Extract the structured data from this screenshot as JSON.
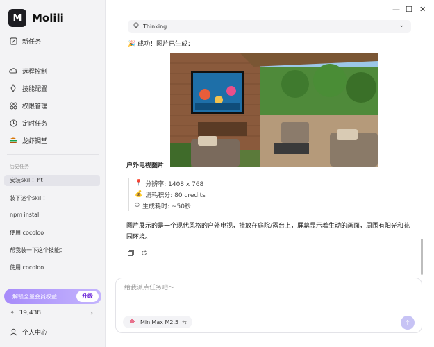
{
  "app": {
    "name": "Molili",
    "logo_text": "M"
  },
  "sidebar": {
    "new_task": "新任务",
    "items": [
      {
        "label": "远程控制",
        "icon": "cloud-icon"
      },
      {
        "label": "技能配置",
        "icon": "skill-icon"
      },
      {
        "label": "权限管理",
        "icon": "grid-icon"
      },
      {
        "label": "定时任务",
        "icon": "clock-icon"
      },
      {
        "label": "龙虾鲷堂",
        "icon": "burger-icon"
      }
    ],
    "history_label": "历史任务",
    "history": [
      "安装skill：ht",
      "装下这个skill：",
      "npm instal",
      "使用 cocoloo",
      "帮我装一下这个技能：",
      "使用 cocoloo"
    ],
    "vip_label": "解锁全量会员权益",
    "vip_button": "升级",
    "credits": "19,438",
    "profile": "个人中心"
  },
  "window_controls": {
    "minimize": "—",
    "maximize": "☐",
    "close": "✕"
  },
  "chat": {
    "thinking_label": "Thinking",
    "success_text": "成功！图片已生成：",
    "image_title": "户外电视图片",
    "meta": [
      {
        "icon": "pin-icon",
        "text": "分辨率: 1408 x 768"
      },
      {
        "icon": "money-bag-icon",
        "text": "消耗积分: 80 credits"
      },
      {
        "icon": "stopwatch-icon",
        "text": "生成耗时: ~50秒"
      }
    ],
    "description": "图片展示的是一个现代风格的户外电视，挂放在庭院/露台上，屏幕显示着生动的画面，周围有阳光和花园环境。"
  },
  "composer": {
    "placeholder": "给我派点任务吧～",
    "model": "MiniMax M2.5"
  },
  "colors": {
    "accent": "#a78bfa",
    "send": "#c7c3f5"
  }
}
